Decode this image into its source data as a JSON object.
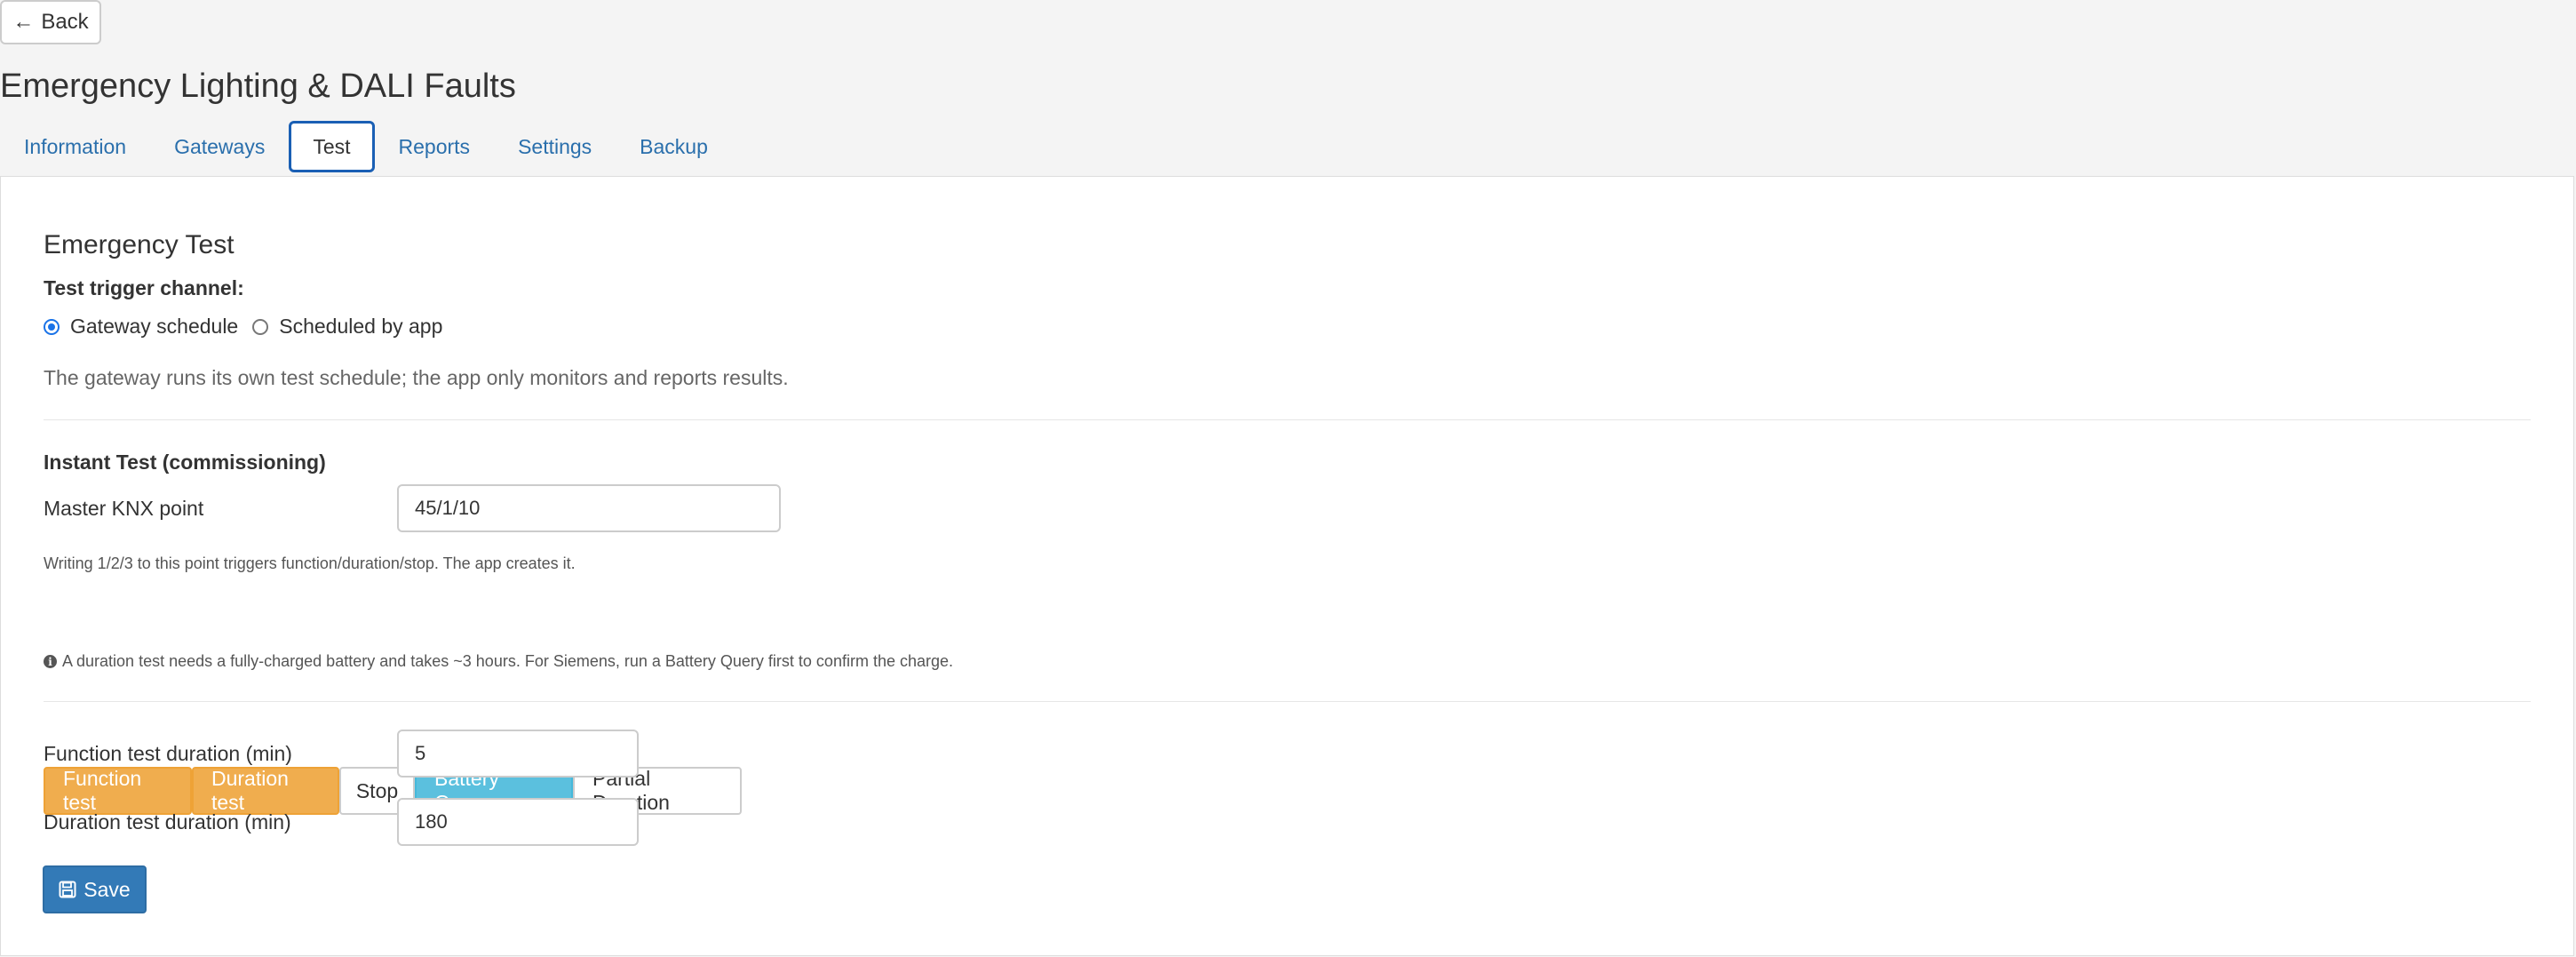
{
  "header": {
    "back_label": "Back",
    "back_icon": "←",
    "title": "Emergency Lighting & DALI Faults"
  },
  "tabs": [
    {
      "label": "Information"
    },
    {
      "label": "Gateways"
    },
    {
      "label": "Test",
      "active": true
    },
    {
      "label": "Reports"
    },
    {
      "label": "Settings"
    },
    {
      "label": "Backup"
    }
  ],
  "emergency_test": {
    "title": "Emergency Test",
    "trigger_label": "Test trigger channel:",
    "options": [
      {
        "label": "Gateway schedule",
        "selected": true
      },
      {
        "label": "Scheduled by app",
        "selected": false
      }
    ],
    "help": "The gateway runs its own test schedule; the app only monitors and reports results."
  },
  "instant_test": {
    "title": "Instant Test (commissioning)",
    "master_label": "Master KNX point",
    "master_value": "45/1/10",
    "master_help": "Writing 1/2/3 to this point triggers function/duration/stop. The app creates it.",
    "buttons": {
      "function_test": "Function test",
      "duration_test": "Duration test",
      "stop": "Stop",
      "battery_query": "Battery Query",
      "partial_duration": "Partial Duration"
    },
    "note": "A duration test needs a fully-charged battery and takes ~3 hours. For Siemens, run a Battery Query first to confirm the charge."
  },
  "durations": {
    "function_label": "Function test duration (min)",
    "function_value": "5",
    "duration_label": "Duration test duration (min)",
    "duration_value": "180"
  },
  "save_label": "Save",
  "colors": {
    "warning": "#f0ad4e",
    "info": "#5bc0de",
    "primary": "#337ab7",
    "link": "#2a6fac"
  }
}
